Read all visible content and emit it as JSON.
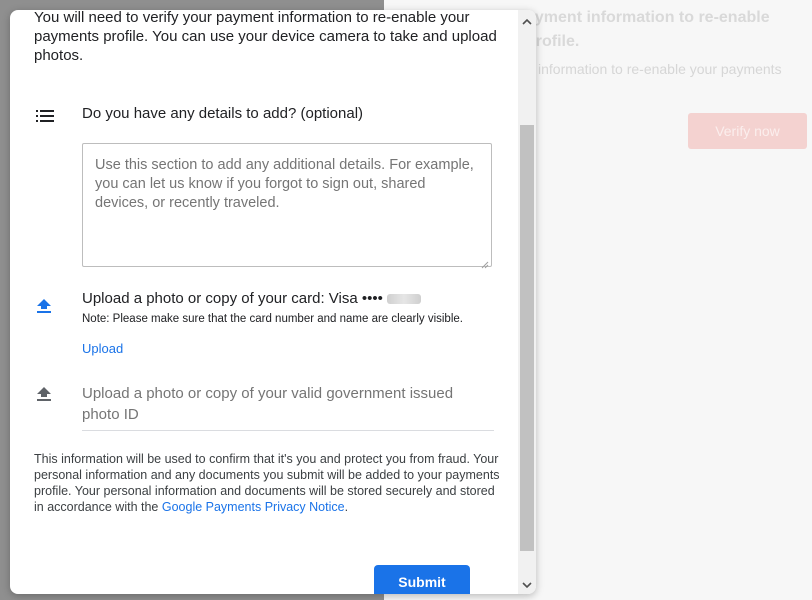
{
  "background": {
    "title": "ayment information to re-enable profile.",
    "subtitle": "information to re-enable your payments",
    "verify_button": "Verify now"
  },
  "dialog": {
    "intro": "You will need to verify your payment information to re-enable your payments profile. You can use your device camera to take and upload photos.",
    "details": {
      "heading": "Do you have any details to add? (optional)",
      "placeholder": "Use this section to add any additional details. For example, you can let us know if you forgot to sign out, shared devices, or recently traveled.",
      "value": ""
    },
    "card_upload": {
      "title_prefix": "Upload a photo or copy of your card: Visa ",
      "masked_digits": "••••",
      "note": "Note: Please make sure that the card number and name are clearly visible.",
      "link": "Upload"
    },
    "id_upload": {
      "title": "Upload a photo or copy of your valid government issued photo ID"
    },
    "disclaimer": {
      "text": "This information will be used to confirm that it's you and protect you from fraud. Your personal information and any documents you submit will be added to your payments profile. Your personal information and documents will be stored securely and stored in accordance with the ",
      "link": "Google Payments Privacy Notice",
      "end": "."
    },
    "submit_label": "Submit"
  },
  "icons": {
    "details": "list-icon",
    "card_upload": "upload-arrow-icon",
    "id_upload": "upload-arrow-icon"
  },
  "colors": {
    "accent": "#1a73e8",
    "verify_disabled": "#f4d2d0"
  }
}
